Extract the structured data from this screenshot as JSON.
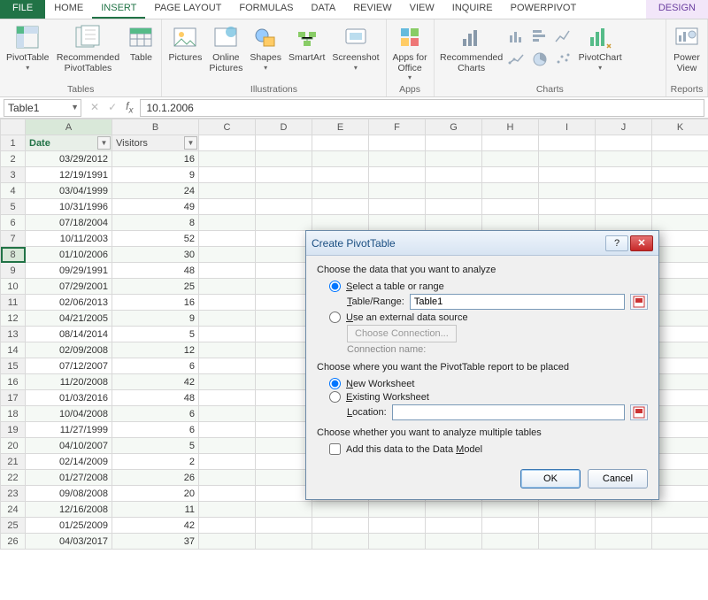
{
  "tabs": {
    "file": "FILE",
    "items": [
      "HOME",
      "INSERT",
      "PAGE LAYOUT",
      "FORMULAS",
      "DATA",
      "REVIEW",
      "VIEW",
      "INQUIRE",
      "POWERPIVOT"
    ],
    "active": "INSERT",
    "context": "DESIGN"
  },
  "ribbon": {
    "groups": {
      "tables": {
        "label": "Tables",
        "pivot": "PivotTable",
        "recommended": "Recommended\nPivotTables",
        "table": "Table"
      },
      "illustrations": {
        "label": "Illustrations",
        "pictures": "Pictures",
        "online": "Online\nPictures",
        "shapes": "Shapes",
        "smartart": "SmartArt",
        "screenshot": "Screenshot"
      },
      "apps": {
        "label": "Apps",
        "appsfor": "Apps for\nOffice"
      },
      "charts": {
        "label": "Charts",
        "recommended": "Recommended\nCharts",
        "pivotchart": "PivotChart"
      },
      "reports": {
        "label": "Reports",
        "powerview": "Power\nView"
      }
    }
  },
  "formula_bar": {
    "name_box": "Table1",
    "formula": "10.1.2006"
  },
  "sheet": {
    "columns": [
      "A",
      "B",
      "C",
      "D",
      "E",
      "F",
      "G",
      "H",
      "I",
      "J",
      "K"
    ],
    "headers": {
      "a": "Date",
      "b": "Visitors"
    },
    "active_cell": "A8",
    "rows": [
      {
        "n": 2,
        "date": "03/29/2012",
        "val": 16,
        "band": true
      },
      {
        "n": 3,
        "date": "12/19/1991",
        "val": 9,
        "band": false
      },
      {
        "n": 4,
        "date": "03/04/1999",
        "val": 24,
        "band": true
      },
      {
        "n": 5,
        "date": "10/31/1996",
        "val": 49,
        "band": false
      },
      {
        "n": 6,
        "date": "07/18/2004",
        "val": 8,
        "band": true
      },
      {
        "n": 7,
        "date": "10/11/2003",
        "val": 52,
        "band": false
      },
      {
        "n": 8,
        "date": "01/10/2006",
        "val": 30,
        "band": true,
        "active": true
      },
      {
        "n": 9,
        "date": "09/29/1991",
        "val": 48,
        "band": false
      },
      {
        "n": 10,
        "date": "07/29/2001",
        "val": 25,
        "band": true
      },
      {
        "n": 11,
        "date": "02/06/2013",
        "val": 16,
        "band": false
      },
      {
        "n": 12,
        "date": "04/21/2005",
        "val": 9,
        "band": true
      },
      {
        "n": 13,
        "date": "08/14/2014",
        "val": 5,
        "band": false
      },
      {
        "n": 14,
        "date": "02/09/2008",
        "val": 12,
        "band": true
      },
      {
        "n": 15,
        "date": "07/12/2007",
        "val": 6,
        "band": false
      },
      {
        "n": 16,
        "date": "11/20/2008",
        "val": 42,
        "band": true
      },
      {
        "n": 17,
        "date": "01/03/2016",
        "val": 48,
        "band": false
      },
      {
        "n": 18,
        "date": "10/04/2008",
        "val": 6,
        "band": true
      },
      {
        "n": 19,
        "date": "11/27/1999",
        "val": 6,
        "band": false
      },
      {
        "n": 20,
        "date": "04/10/2007",
        "val": 5,
        "band": true
      },
      {
        "n": 21,
        "date": "02/14/2009",
        "val": 2,
        "band": false
      },
      {
        "n": 22,
        "date": "01/27/2008",
        "val": 26,
        "band": true
      },
      {
        "n": 23,
        "date": "09/08/2008",
        "val": 20,
        "band": false
      },
      {
        "n": 24,
        "date": "12/16/2008",
        "val": 11,
        "band": true
      },
      {
        "n": 25,
        "date": "01/25/2009",
        "val": 42,
        "band": false
      },
      {
        "n": 26,
        "date": "04/03/2017",
        "val": 37,
        "band": true
      }
    ]
  },
  "dialog": {
    "title": "Create PivotTable",
    "sect1": "Choose the data that you want to analyze",
    "opt_select": "Select a table or range",
    "table_range_lbl_pre": "T",
    "table_range_lbl_post": "able/Range:",
    "table_range_val": "Table1",
    "opt_external_pre": "U",
    "opt_external_post": "se an external data source",
    "choose_conn": "Choose Connection...",
    "conn_name": "Connection name:",
    "sect2": "Choose where you want the PivotTable report to be placed",
    "opt_new_pre": "N",
    "opt_new_post": "ew Worksheet",
    "opt_existing_pre": "E",
    "opt_existing_post": "xisting Worksheet",
    "location_lbl_pre": "L",
    "location_lbl_post": "ocation:",
    "location_val": "",
    "sect3": "Choose whether you want to analyze multiple tables",
    "opt_model_pre": "Add this data to the Data ",
    "opt_model_char": "M",
    "opt_model_post": "odel",
    "ok": "OK",
    "cancel": "Cancel"
  }
}
